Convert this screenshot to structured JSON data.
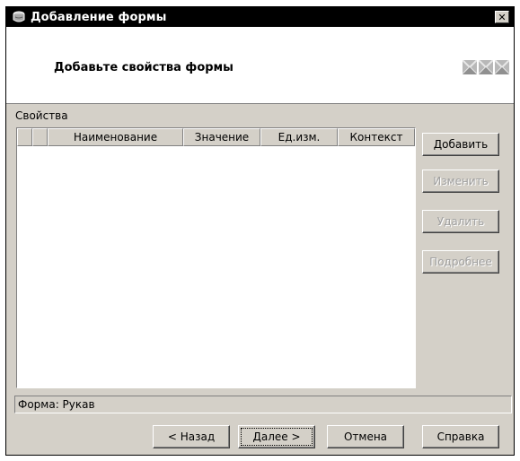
{
  "window": {
    "title": "Добавление формы",
    "close_label": "✕"
  },
  "header": {
    "title": "Добавьте свойства формы"
  },
  "properties": {
    "label": "Свойства",
    "columns": [
      "",
      "",
      "Наименование",
      "Значение",
      "Ед.изм.",
      "Контекст"
    ]
  },
  "side_buttons": {
    "add": "Добавить",
    "edit": "Изменить",
    "delete": "Удалить",
    "details": "Подробнее"
  },
  "status": {
    "text": "Форма: Рукав"
  },
  "footer_buttons": {
    "back": "< Назад",
    "next": "Далее >",
    "cancel": "Отмена",
    "help": "Справка"
  }
}
